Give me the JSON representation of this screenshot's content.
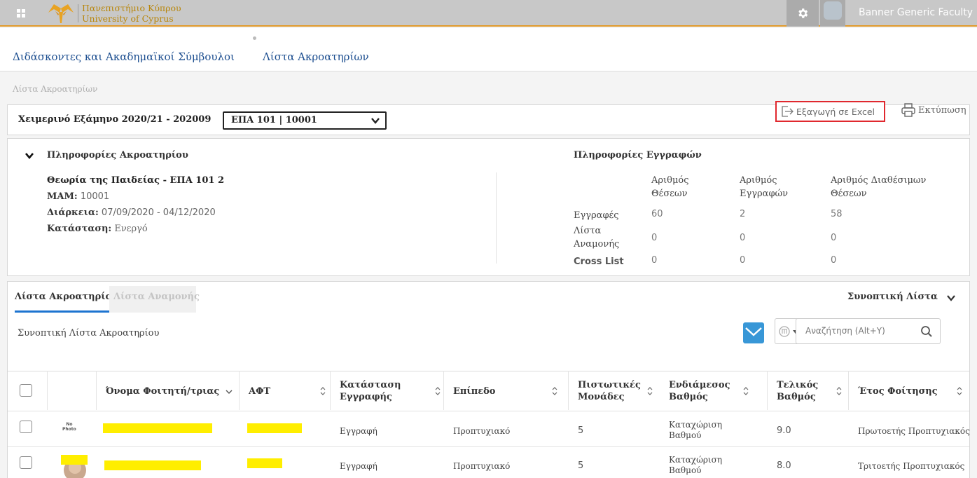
{
  "header": {
    "logo_text_gr": "Πανεπιστήμιο Κύπρου",
    "logo_text_en": "University of Cyprus",
    "user_label": "Banner Generic Faculty",
    "colors": {
      "bar": "#c8c8c8",
      "accent": "#e19a2a",
      "logo": "#b8860b"
    }
  },
  "breadcrumb": {
    "items": [
      "Διδάσκοντες και Ακαδημαϊκοί Σύμβουλοι",
      "Λίστα Ακροατηρίων"
    ]
  },
  "page_title": "Λίστα Ακροατηρίων",
  "filter": {
    "term": "Χειμερινό Εξάμηνο 2020/21 - 202009",
    "course_selected": "ΕΠΑ 101 | 10001",
    "export_label": "Εξαγωγή σε Excel",
    "print_label": "Εκτύπωση"
  },
  "course_info": {
    "section_title": "Πληροφορίες Ακροατηρίου",
    "title": "Θεωρία της Παιδείας - ΕΠΑ 101 2",
    "crn_label": "ΜΑΜ:",
    "crn_value": "10001",
    "duration_label": "Διάρκεια:",
    "duration_value": "07/09/2020 - 04/12/2020",
    "status_label": "Κατάσταση:",
    "status_value": "Ενεργό"
  },
  "enrollment": {
    "section_title": "Πληροφορίες Εγγραφών",
    "columns": [
      {
        "line1": "Αριθμός",
        "line2": "Θέσεων"
      },
      {
        "line1": "Αριθμός",
        "line2": "Εγγραφών"
      },
      {
        "line1": "Αριθμός Διαθέσιμων",
        "line2": "Θέσεων"
      }
    ],
    "rows": [
      {
        "label1": "Εγγραφές",
        "label2": "",
        "values": [
          "60",
          "2",
          "58"
        ]
      },
      {
        "label1": "Λίστα",
        "label2": "Αναμονής",
        "values": [
          "0",
          "0",
          "0"
        ]
      },
      {
        "label1": "Cross List",
        "label2": "",
        "values": [
          "0",
          "0",
          "0"
        ]
      }
    ]
  },
  "roster": {
    "tab_active": "Λίστα Ακροατηρίου",
    "tab_inactive": "Λίστα Αναμονής",
    "summary_toggle": "Συνοπτική Λίστα",
    "section_label": "Συνοπτική Λίστα Ακροατηρίου",
    "search_placeholder": "Αναζήτηση (Alt+Y)",
    "columns": {
      "name": "Όνομα Φοιτητή/τριας",
      "id": "ΑΦΤ",
      "reg_status_1": "Κατάσταση",
      "reg_status_2": "Εγγραφής",
      "level": "Επίπεδο",
      "credits_1": "Πιστωτικές",
      "credits_2": "Μονάδες",
      "midterm_1": "Ενδιάμεσος",
      "midterm_2": "Βαθμός",
      "final_1": "Τελικός",
      "final_2": "Βαθμός",
      "year": "Έτος Φοίτησης"
    },
    "rows": [
      {
        "photo_1": "No",
        "photo_2": "Photo",
        "reg_status": "Εγγραφή",
        "level": "Προπτυχιακό",
        "credits": "5",
        "midterm_1": "Καταχώριση",
        "midterm_2": "Βαθμού",
        "final": "9.0",
        "year": "Πρωτοετής Προπτυχιακός"
      },
      {
        "photo_1": "",
        "photo_2": "",
        "reg_status": "Εγγραφή",
        "level": "Προπτυχιακό",
        "credits": "5",
        "midterm_1": "Καταχώριση",
        "midterm_2": "Βαθμού",
        "final": "8.0",
        "year": "Τριτοετής Προπτυχιακός"
      }
    ]
  }
}
